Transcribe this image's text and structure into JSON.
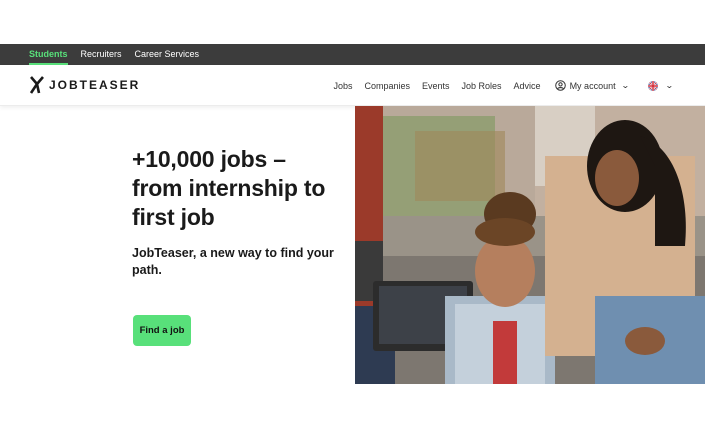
{
  "audience_nav": {
    "items": [
      {
        "label": "Students",
        "active": true
      },
      {
        "label": "Recruiters",
        "active": false
      },
      {
        "label": "Career Services",
        "active": false
      }
    ]
  },
  "header": {
    "logo_text": "JOBTEASER",
    "links": [
      "Jobs",
      "Companies",
      "Events",
      "Job Roles",
      "Advice"
    ],
    "account_label": "My account",
    "account_icon": "user-circle-icon",
    "language_icon": "uk-flag-icon"
  },
  "hero": {
    "title": "+10,000 jobs – from internship to first job",
    "subtitle": "JobTeaser, a new way to find your path.",
    "cta_label": "Find a job"
  },
  "colors": {
    "accent": "#58e07a",
    "top_bar": "#3c3c3c",
    "text": "#1a1a1a"
  }
}
